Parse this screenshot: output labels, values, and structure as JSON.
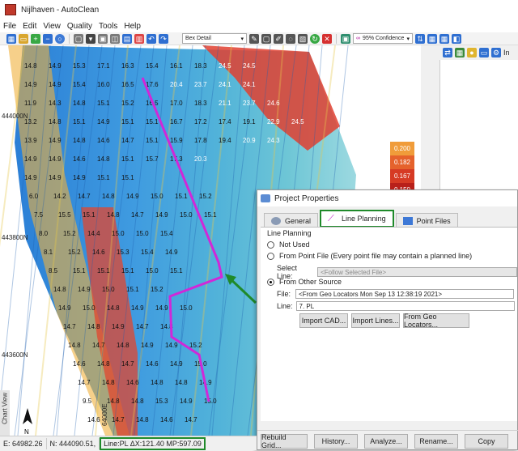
{
  "window": {
    "title": "Nijlhaven - AutoClean"
  },
  "menu": [
    "File",
    "Edit",
    "View",
    "Quality",
    "Tools",
    "Help"
  ],
  "toolbar": {
    "style_select": "Bex Detail",
    "confidence_select": "95% Confidence"
  },
  "right_dock": {
    "label": "In"
  },
  "map": {
    "northings": [
      "444000N",
      "443800N",
      "443600N"
    ],
    "easting_label": "64000E",
    "depth_labels": [
      [
        "14.8",
        "14.9",
        "15.3",
        "17.1",
        "16.3",
        "15.4",
        "16.1",
        "18.3",
        "24.5",
        "24.5"
      ],
      [
        "14.9",
        "14.9",
        "15.4",
        "16.0",
        "16.5",
        "17.6",
        "20.4",
        "23.7",
        "24.1",
        "24.1"
      ],
      [
        "11.9",
        "14.3",
        "14.8",
        "15.1",
        "15.2",
        "16.5",
        "17.0",
        "18.3",
        "21.1",
        "23.7",
        "24.6"
      ],
      [
        "13.2",
        "14.8",
        "15.1",
        "14.9",
        "15.1",
        "15.1",
        "16.7",
        "17.2",
        "17.4",
        "19.1",
        "22.9",
        "24.5"
      ],
      [
        "13.9",
        "14.9",
        "14.8",
        "14.6",
        "14.7",
        "15.1",
        "15.9",
        "17.8",
        "19.4",
        "20.9",
        "24.3"
      ],
      [
        "14.9",
        "14.9",
        "14.6",
        "14.8",
        "15.1",
        "15.7",
        "17.3",
        "20.3"
      ],
      [
        "14.9",
        "14.9",
        "14.9",
        "15.1",
        "15.1"
      ],
      [
        "6.0",
        "14.2",
        "14.7",
        "14.8",
        "14.9",
        "15.0",
        "15.1",
        "15.2"
      ],
      [
        "7.5",
        "15.5",
        "15.1",
        "14.8",
        "14.7",
        "14.9",
        "15.0",
        "15.1"
      ],
      [
        "8.0",
        "15.2",
        "14.4",
        "15.0",
        "15.0",
        "15.4"
      ],
      [
        "8.1",
        "15.2",
        "14.6",
        "15.3",
        "15.4",
        "14.9"
      ],
      [
        "8.5",
        "15.1",
        "15.1",
        "15.1",
        "15.0",
        "15.1"
      ],
      [
        "14.8",
        "14.9",
        "15.0",
        "15.1",
        "15.2"
      ],
      [
        "14.9",
        "15.0",
        "14.8",
        "14.9",
        "14.9",
        "15.0"
      ],
      [
        "14.7",
        "14.8",
        "14.9",
        "14.7",
        "14.8"
      ],
      [
        "14.8",
        "14.7",
        "14.8",
        "14.9",
        "14.9",
        "15.2"
      ],
      [
        "14.6",
        "14.8",
        "14.7",
        "14.6",
        "14.9",
        "15.0"
      ],
      [
        "14.7",
        "14.8",
        "14.6",
        "14.8",
        "14.8",
        "14.9"
      ],
      [
        "9.5",
        "14.8",
        "14.8",
        "15.3",
        "14.9",
        "15.0"
      ],
      [
        "14.6",
        "14.7",
        "14.8",
        "14.6",
        "14.7"
      ]
    ],
    "legend": [
      "0.200",
      "0.182",
      "0.167",
      "0.150"
    ],
    "north_label": "N",
    "chart_view_label": "Chart View"
  },
  "dialog": {
    "title": "Project Properties",
    "tabs": [
      "General",
      "Line Planning",
      "Point Files"
    ],
    "active_tab": "Line Planning",
    "group_label": "Line Planning",
    "options": [
      "Not Used",
      "From Point File (Every point file may contain a planned line)",
      "From Other Source"
    ],
    "selected_option": "From Other Source",
    "select_line_label": "Select Line:",
    "select_line_value": "<Follow Selected File>",
    "file_label": "File:",
    "file_value": "<From Geo Locators Mon Sep 13 12:38:19 2021>",
    "line_label": "Line:",
    "line_value": "7. PL",
    "import_buttons": [
      "Import CAD...",
      "Import Lines...",
      "From Geo Locators..."
    ],
    "bottom_buttons": [
      "Rebuild Grid...",
      "History...",
      "Analyze...",
      "Rename...",
      "Copy"
    ]
  },
  "statusbar": {
    "e": "E: 64982.26",
    "n": "N: 444090.51,",
    "line": "Line:PL ΔX:121.40 MP:597.09"
  }
}
